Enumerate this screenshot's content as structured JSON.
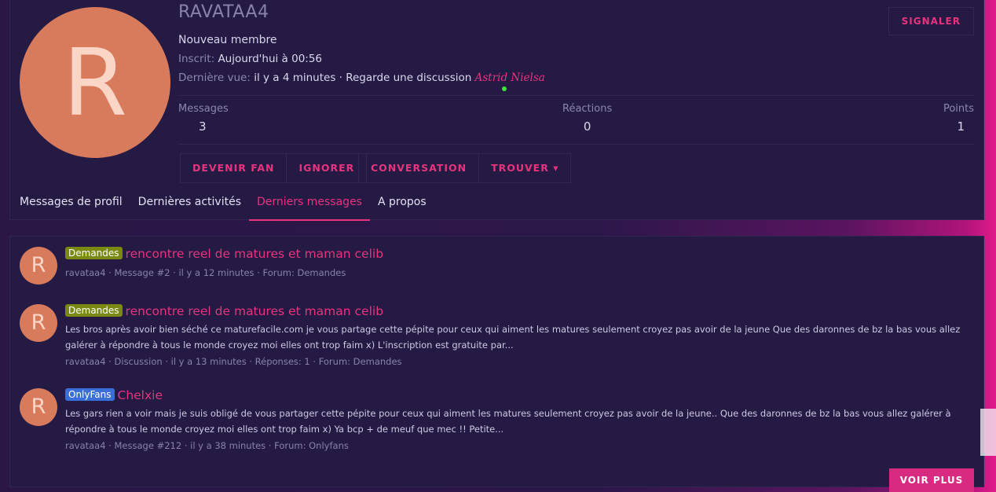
{
  "profile": {
    "avatar_letter": "R",
    "username": "RAVATAA4",
    "role": "Nouveau membre",
    "registered_label": "Inscrit:",
    "registered_value": "Aujourd'hui à 00:56",
    "last_seen_label": "Dernière vue:",
    "last_seen_value": "il y a 4 minutes · Regarde une discussion",
    "last_seen_link": "Astrid Nielsa",
    "report_label": "SIGNALER",
    "stats": [
      {
        "label": "Messages",
        "value": "3"
      },
      {
        "label": "Réactions",
        "value": "0"
      },
      {
        "label": "Points",
        "value": "1"
      }
    ],
    "actions": {
      "become_fan": "DEVENIR FAN",
      "ignore": "IGNORER",
      "conversation": "CONVERSATION",
      "find": "TROUVER ▾"
    },
    "tabs": [
      "Messages de profil",
      "Dernières activités",
      "Derniers messages",
      "A propos"
    ],
    "active_tab": "Derniers messages"
  },
  "posts": [
    {
      "avatar_letter": "R",
      "prefix": "Demandes",
      "title": "rencontre reel de matures et maman celib",
      "snippet": "",
      "meta": "ravataa4 · Message #2 · il y a 12 minutes · Forum: Demandes"
    },
    {
      "avatar_letter": "R",
      "prefix": "Demandes",
      "title": "rencontre reel de matures et maman celib",
      "snippet": "Les bros après avoir bien séché ce maturefacile.com je vous partage cette pépite pour ceux qui aiment les matures seulement croyez pas avoir de la jeune Que des daronnes de bz la bas vous allez galérer à répondre à tous le monde croyez moi elles ont trop faim x) L'inscription est gratuite par...",
      "meta": "ravataa4 · Discussion · il y a 13 minutes · Réponses: 1 · Forum: Demandes"
    },
    {
      "avatar_letter": "R",
      "prefix": "OnlyFans",
      "title": "Chelxie",
      "snippet": "Les gars rien a voir mais je suis obligé de vous partager cette pépite pour ceux qui aiment les matures seulement croyez pas avoir de la jeune.. Que des daronnes de bz la bas vous allez galérer à répondre à tous le monde croyez moi elles ont trop faim x) Ya bcp + de meuf que mec !! Petite...",
      "meta": "ravataa4 · Message #212 · il y a 38 minutes · Forum: Onlyfans"
    }
  ],
  "more_label": "VOIR PLUS",
  "colors": {
    "accent": "#e8347e",
    "card_bg": "#241a44",
    "avatar_bg": "#d87b5c",
    "prefix_demandes": "#7a8a10",
    "prefix_onlyfans": "#3a6fd8",
    "online": "#3fe23f"
  }
}
